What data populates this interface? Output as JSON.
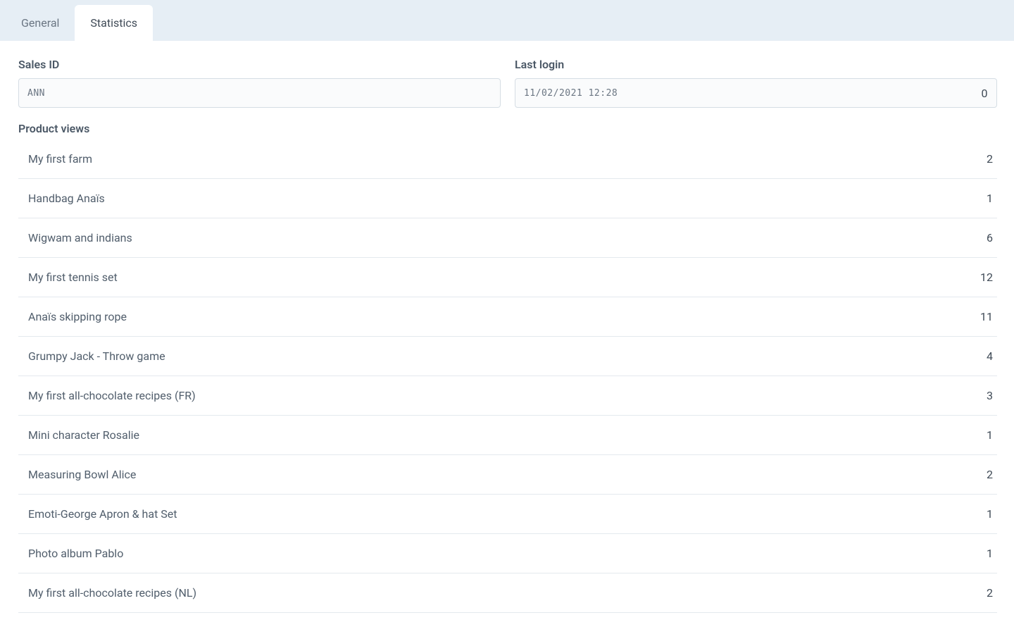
{
  "tabs": [
    {
      "label": "General",
      "active": false
    },
    {
      "label": "Statistics",
      "active": true
    }
  ],
  "fields": {
    "sales_id": {
      "label": "Sales ID",
      "value": "ANN"
    },
    "last_login": {
      "label": "Last login",
      "value": "11/02/2021 12:28",
      "extra": "0"
    }
  },
  "product_views": {
    "label": "Product views",
    "items": [
      {
        "name": "My first farm",
        "count": 2
      },
      {
        "name": "Handbag Anaïs",
        "count": 1
      },
      {
        "name": "Wigwam and indians",
        "count": 6
      },
      {
        "name": "My first tennis set",
        "count": 12
      },
      {
        "name": "Anaïs skipping rope",
        "count": 11
      },
      {
        "name": "Grumpy Jack - Throw game",
        "count": 4
      },
      {
        "name": "My first all-chocolate recipes (FR)",
        "count": 3
      },
      {
        "name": "Mini character Rosalie",
        "count": 1
      },
      {
        "name": "Measuring Bowl Alice",
        "count": 2
      },
      {
        "name": "Emoti-George Apron & hat Set",
        "count": 1
      },
      {
        "name": "Photo album Pablo",
        "count": 1
      },
      {
        "name": "My first all-chocolate recipes (NL)",
        "count": 2
      }
    ]
  }
}
